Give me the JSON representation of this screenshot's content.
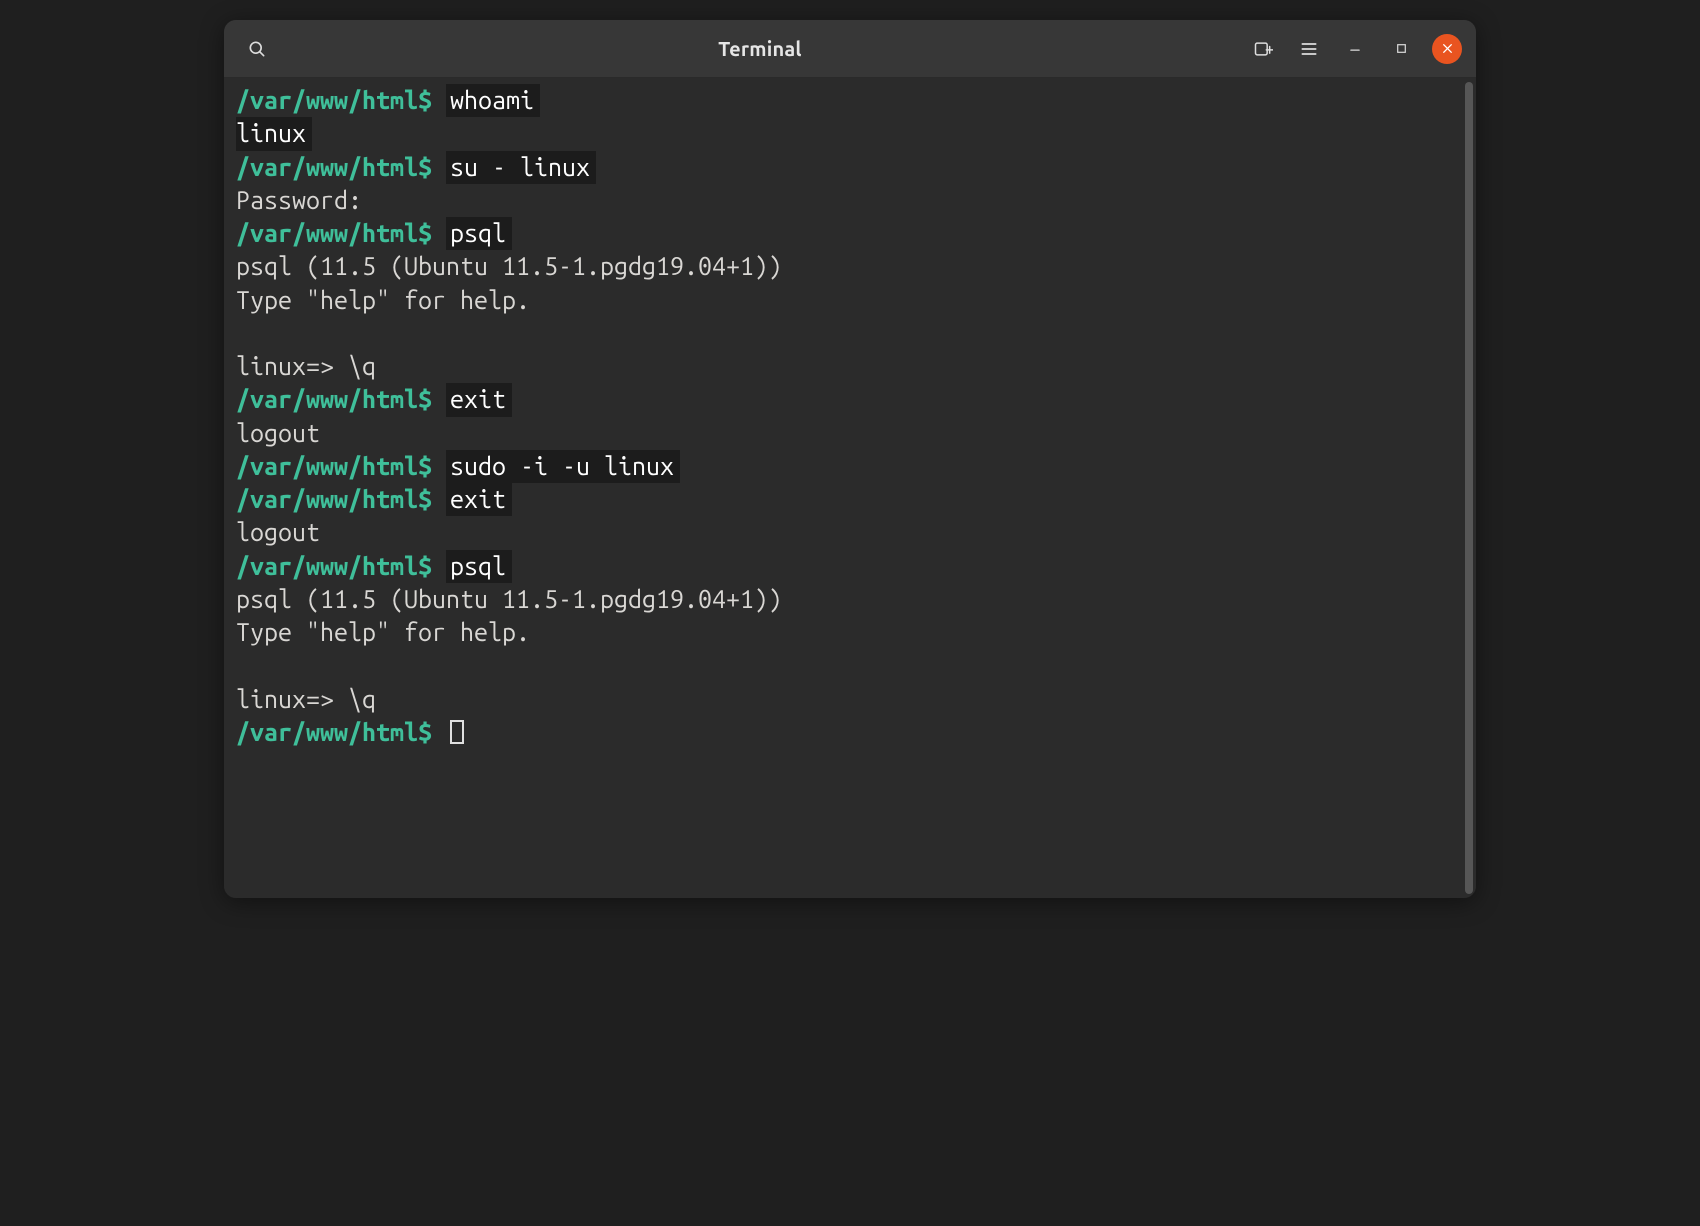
{
  "titlebar": {
    "title": "Terminal"
  },
  "colors": {
    "prompt": "#3fbf9a",
    "foreground": "#d9d7d4",
    "background": "#2b2b2b",
    "cmd_highlight_bg": "#1c1c1c",
    "close_button": "#e95420"
  },
  "terminal": {
    "prompt_path": "/var/www/html",
    "prompt_suffix": "$",
    "lines": [
      {
        "type": "prompt",
        "cmd": "whoami"
      },
      {
        "type": "output_hl",
        "text": "linux"
      },
      {
        "type": "prompt",
        "cmd": "su - linux"
      },
      {
        "type": "output",
        "text": "Password:"
      },
      {
        "type": "prompt",
        "cmd": "psql"
      },
      {
        "type": "output",
        "text": "psql (11.5 (Ubuntu 11.5-1.pgdg19.04+1))"
      },
      {
        "type": "output",
        "text": "Type \"help\" for help."
      },
      {
        "type": "blank"
      },
      {
        "type": "output",
        "text": "linux=> \\q"
      },
      {
        "type": "prompt",
        "cmd": "exit"
      },
      {
        "type": "output",
        "text": "logout"
      },
      {
        "type": "prompt",
        "cmd": "sudo -i -u linux"
      },
      {
        "type": "prompt",
        "cmd": "exit"
      },
      {
        "type": "output",
        "text": "logout"
      },
      {
        "type": "prompt",
        "cmd": "psql"
      },
      {
        "type": "output",
        "text": "psql (11.5 (Ubuntu 11.5-1.pgdg19.04+1))"
      },
      {
        "type": "output",
        "text": "Type \"help\" for help."
      },
      {
        "type": "blank"
      },
      {
        "type": "output",
        "text": "linux=> \\q"
      },
      {
        "type": "prompt_cursor"
      }
    ]
  }
}
